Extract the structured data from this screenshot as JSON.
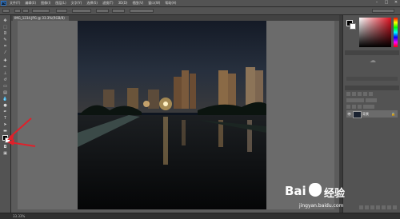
{
  "menubar": {
    "logo": "Ps",
    "items": [
      "文件(F)",
      "编辑(E)",
      "图像(I)",
      "图层(L)",
      "文字(Y)",
      "选择(S)",
      "滤镜(T)",
      "3D(D)",
      "视图(V)",
      "窗口(W)",
      "帮助(H)"
    ],
    "window_controls": [
      "–",
      "□",
      "✕"
    ]
  },
  "document": {
    "tab_title": "IMG_1234.JPG @ 33.3%(RGB/8)",
    "status": "33.33%"
  },
  "layers": {
    "layer_name": "背景"
  },
  "watermark": {
    "brand": "Bai",
    "suffix": "经验",
    "url": "jingyan.baidu.com"
  },
  "colors": {
    "fg": "#000000",
    "bg": "#ffffff",
    "arrow": "#e0202a"
  }
}
